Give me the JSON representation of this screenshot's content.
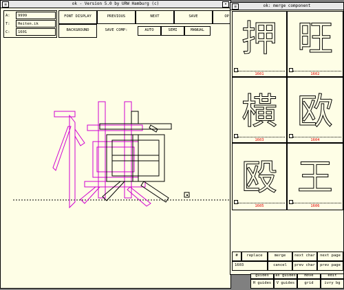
{
  "main": {
    "title": "ok - Version 5.0 by URW Hamburg (c)",
    "info": [
      {
        "label": "A:",
        "value": "9999"
      },
      {
        "label": "T:",
        "value": "Heiten.ik"
      },
      {
        "label": "C:",
        "value": "1601"
      }
    ],
    "buttons": {
      "font_display": "FONT DISPLAY",
      "previous": "PREVIOUS",
      "next": "NEXT",
      "save": "SAVE",
      "op": "OP",
      "background": "BACKGROUND",
      "save_comp": "SAVE COMP:",
      "auto": "AUTO",
      "semi": "SEMI",
      "manual": "MANUAL"
    },
    "canvas": {
      "main_glyph": "橫",
      "overlay_glyph": "積",
      "outline_color": "#000000",
      "reference_color": "#d000d0"
    }
  },
  "merge": {
    "title": "ok: merge component",
    "cells": [
      {
        "glyph": "押",
        "code": "1601"
      },
      {
        "glyph": "旺",
        "code": "1602"
      },
      {
        "glyph": "橫",
        "code": "1603"
      },
      {
        "glyph": "欧",
        "code": "1604"
      },
      {
        "glyph": "殴",
        "code": "1605"
      },
      {
        "glyph": "王",
        "code": "1606"
      }
    ],
    "actions": {
      "hash": "#",
      "replace": "replace",
      "merge": "merge",
      "next_char": "next char",
      "next_page": "next page",
      "value": "1603",
      "cancel": "cancel",
      "prev_char": "prev char",
      "prev_page": "prev page"
    },
    "code_color": "#e00000"
  },
  "bottom_bar": {
    "row1": [
      "guides",
      "as guides",
      "move",
      "edit"
    ],
    "row2": [
      "H guides",
      "V guides",
      "grid",
      "ivry bg"
    ]
  }
}
